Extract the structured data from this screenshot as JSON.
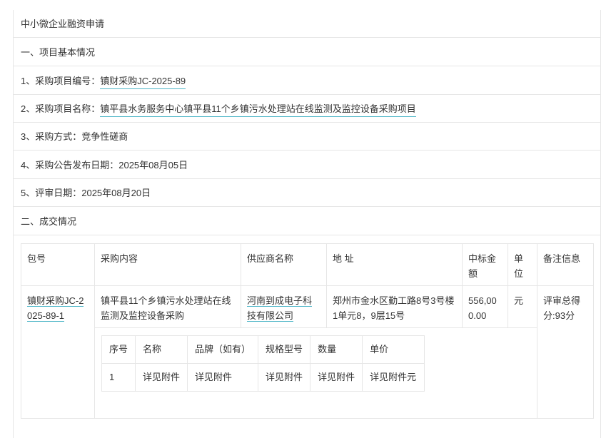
{
  "page": {
    "title": "中小微企业融资申请",
    "section1": "一、项目基本情况",
    "project_no_label": "1、采购项目编号：",
    "project_no": "镇财采购JC-2025-89",
    "project_name_label": "2、采购项目名称：",
    "project_name": "镇平县水务服务中心镇平县11个乡镇污水处理站在线监测及监控设备采购项目",
    "method": "3、采购方式：竞争性磋商",
    "publish_date": "4、采购公告发布日期：2025年08月05日",
    "review_date": "5、评审日期：2025年08月20日",
    "section2": "二、成交情况"
  },
  "deal_table": {
    "headers": [
      "包号",
      "采购内容",
      "供应商名称",
      "地 址",
      "中标金额",
      "单位",
      "备注信息"
    ],
    "row": {
      "package_no": "镇财采购JC-2025-89-1",
      "content": "镇平县11个乡镇污水处理站在线监测及监控设备采购",
      "supplier": "河南到成电子科技有限公司",
      "address": "郑州市金水区勤工路8号3号楼1单元8，9层15号",
      "amount": "556,000.00",
      "unit": "元",
      "remark": "评审总得分:93分"
    }
  },
  "item_table": {
    "headers": [
      "序号",
      "名称",
      "品牌（如有）",
      "规格型号",
      "数量",
      "单价"
    ],
    "row": [
      "1",
      "详见附件",
      "详见附件",
      "详见附件",
      "详见附件",
      "详见附件元"
    ]
  }
}
